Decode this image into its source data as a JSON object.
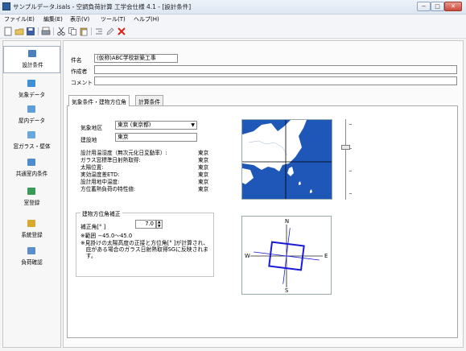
{
  "window": {
    "title": "サンプルデータ.isals - 空調負荷計算 工学会仕様 4.1 - [設計条件]",
    "min": "−",
    "max": "□",
    "close": "✕"
  },
  "menu": [
    "ファイル(E)",
    "編集(E)",
    "表示(V)",
    "ツール(T)",
    "ヘルプ(H)"
  ],
  "toolbar_icons": [
    "new-icon",
    "open-icon",
    "save-icon",
    "print-icon",
    "cut-icon",
    "copy-icon",
    "paste-icon",
    "indent-icon",
    "edit-icon",
    "delete-icon"
  ],
  "nav": [
    {
      "label": "設計条件",
      "icon": "design-conditions-icon",
      "color": "#4a7fc0",
      "selected": true
    },
    {
      "label": "気象データ",
      "icon": "weather-data-icon",
      "color": "#3f8fd6",
      "selected": false
    },
    {
      "label": "屋内データ",
      "icon": "indoor-data-icon",
      "color": "#5f9ed9",
      "selected": false
    },
    {
      "label": "窓ガラス・壁体",
      "icon": "window-wall-icon",
      "color": "#6aa7dc",
      "selected": false
    },
    {
      "label": "共通室内条件",
      "icon": "common-room-icon",
      "color": "#4f8ccc",
      "selected": false
    },
    {
      "label": "室登録",
      "icon": "room-register-icon",
      "color": "#3c9a58",
      "selected": false
    },
    {
      "label": "系統登録",
      "icon": "system-register-icon",
      "color": "#d9a82e",
      "selected": false
    },
    {
      "label": "負荷確認",
      "icon": "load-check-icon",
      "color": "#5c8fc9",
      "selected": false
    }
  ],
  "form": {
    "project_label": "件名",
    "project_value": "(仮称)ABC学校新築工事",
    "author_label": "作成者",
    "author_value": "",
    "comment_label": "コメント",
    "comment_value": ""
  },
  "tabs": {
    "weather": "気象条件・建物方位角",
    "calc": "計算条件"
  },
  "weather": {
    "region_label": "気象地区",
    "region_value": "東京 (東京都)",
    "site_label": "建設地",
    "site_value": "東京",
    "rows": [
      {
        "label": "設計用温湿度（無次元化日変動率）:",
        "value": "東京"
      },
      {
        "label": "ガラス窓標準日射熱取得:",
        "value": "東京"
      },
      {
        "label": "太陽位置:",
        "value": "東京"
      },
      {
        "label": "実効温度差ETD:",
        "value": "東京"
      },
      {
        "label": "設計用地中温度:",
        "value": "東京"
      },
      {
        "label": "方位蓄熱負荷の特性値:",
        "value": "東京"
      }
    ]
  },
  "orientation": {
    "group_label": "建物方位角補正",
    "angle_label": "補正角[° ]",
    "angle_value": "7.0",
    "range_note": "※範囲 −45.0〜45.0",
    "note_lines": [
      "※見掛けの太陽高度の正接と方位角[° ]が計算され、",
      "　庇がある場合のガラス日射熱取得SGに反映されま",
      "　す。"
    ],
    "compass": {
      "n": "N",
      "s": "S",
      "e": "E",
      "w": "W"
    }
  },
  "colors": {
    "map_sea": "#1f57b8",
    "map_land": "#ffffff",
    "building": "#1a1ad8"
  }
}
